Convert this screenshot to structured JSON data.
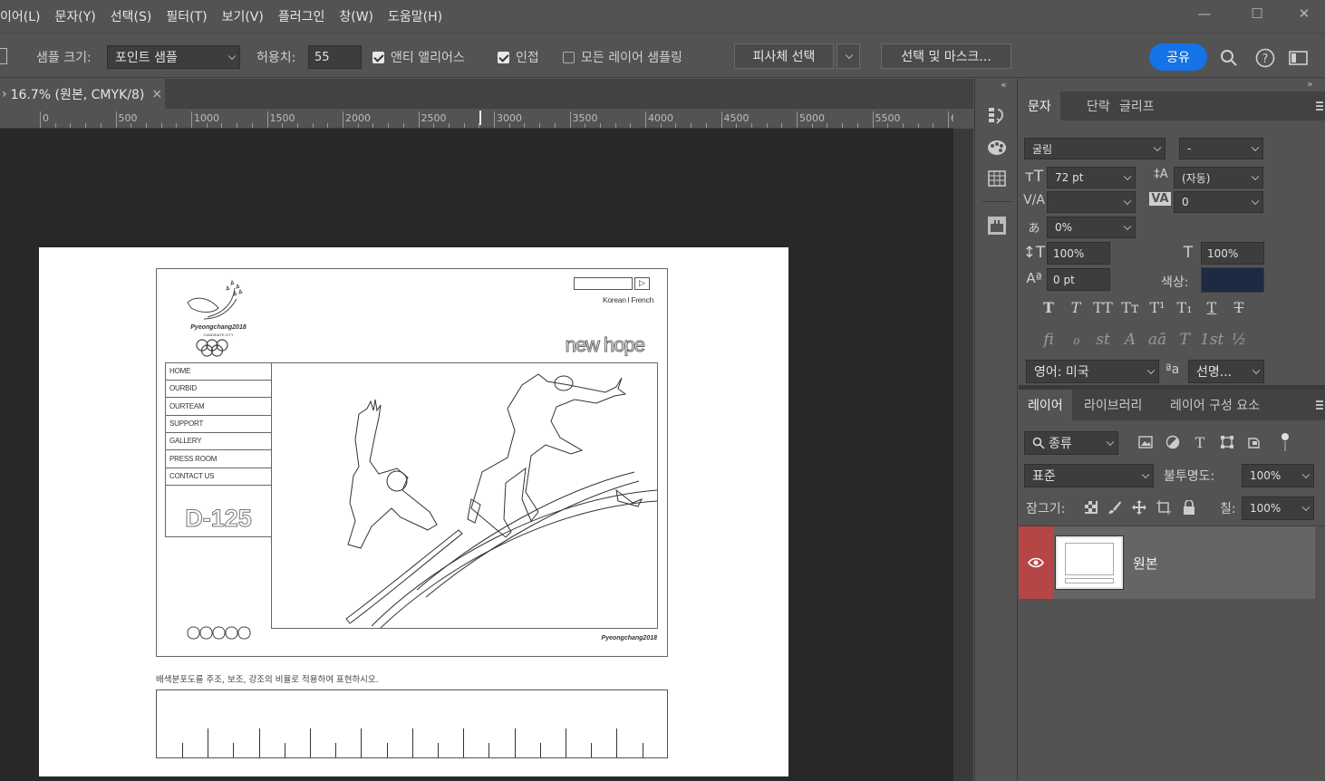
{
  "menubar": {
    "items": [
      "이어(L)",
      "문자(Y)",
      "선택(S)",
      "필터(T)",
      "보기(V)",
      "플러그인",
      "창(W)",
      "도움말(H)"
    ],
    "minimize": "—",
    "maximize": "☐",
    "close": "✕"
  },
  "options": {
    "sample_size_label": "샘플 크기:",
    "sample_size_value": "포인트 샘플",
    "tolerance_label": "허용치:",
    "tolerance_value": "55",
    "antialias_label": "앤티 앨리어스",
    "contiguous_label": "인접",
    "sample_all_label": "모든 레이어 샘플링",
    "subject_select": "피사체 선택",
    "select_mask": "선택 및 마스크...",
    "share": "공유",
    "antialias_checked": true,
    "contiguous_checked": true,
    "sample_all_checked": false
  },
  "document": {
    "tab_title": "16.7% (원본, CMYK/8)",
    "tab_close": "×"
  },
  "ruler": {
    "labels": [
      "0",
      "500",
      "1000",
      "1500",
      "2000",
      "2500",
      "3000",
      "3500",
      "4000",
      "4500",
      "5000",
      "5500",
      "6"
    ]
  },
  "artwork": {
    "logo_text": "Pyeongchang2018",
    "logo_sub": "CANDIDATE CITY",
    "lang_links": "Korean l French",
    "slogan": "new hope",
    "nav": [
      "HOME",
      "OURBID",
      "OURTEAM",
      "SUPPORT",
      "GALLERY",
      "PRESS ROOM",
      "CONTACT US"
    ],
    "countdown": "D-125",
    "footer_brand": "Pyeongchang2018",
    "instruction": "배색분포도를 주조, 보조, 강조의 비율로 적용하여 표현하시오."
  },
  "char_panel": {
    "tabs": [
      "문자",
      "단락",
      "글리프"
    ],
    "font_family": "굴림",
    "font_style": "-",
    "font_size": "72 pt",
    "leading": "(자동)",
    "kerning": "",
    "tracking": "0",
    "tsume": "0%",
    "vscale": "100%",
    "hscale": "100%",
    "baseline": "0 pt",
    "color_label": "색상:",
    "color_value": "#1e2a44",
    "style_buttons": [
      "T",
      "T",
      "TT",
      "Tт",
      "T¹",
      "T₁",
      "T",
      "T"
    ],
    "opentype_buttons": [
      "ﬁ",
      "ℴ",
      "st",
      "A",
      "aā",
      "T",
      "1st",
      "½"
    ],
    "language": "영어: 미국",
    "aa_label": "ªa",
    "aa_method": "선명..."
  },
  "layers_panel": {
    "tabs": [
      "레이어",
      "라이브러리",
      "레이어 구성 요소"
    ],
    "filter_kind": "종류",
    "blend_mode": "표준",
    "opacity_label": "불투명도:",
    "opacity_value": "100%",
    "lock_label": "잠그기:",
    "fill_label": "칠:",
    "fill_value": "100%",
    "layers": [
      {
        "name": "원본",
        "visible": true
      }
    ]
  }
}
